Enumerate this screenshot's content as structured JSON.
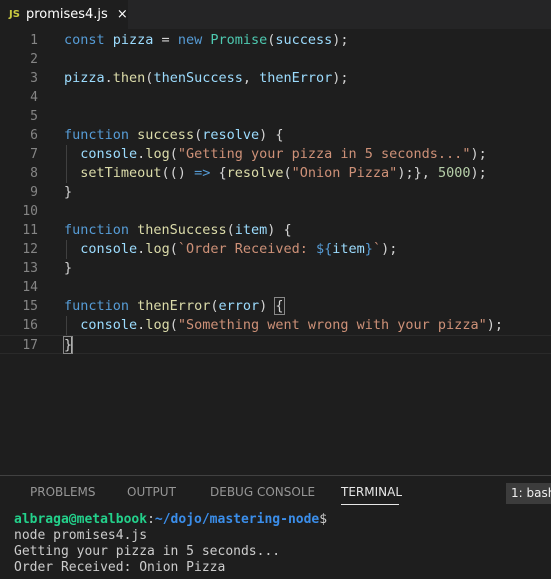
{
  "tab": {
    "badge": "JS",
    "filename": "promises4.js",
    "close": "×"
  },
  "editor": {
    "line_numbers": [
      "1",
      "2",
      "3",
      "4",
      "5",
      "6",
      "7",
      "8",
      "9",
      "10",
      "11",
      "12",
      "13",
      "14",
      "15",
      "16",
      "17"
    ],
    "lines": [
      [
        [
          "kw",
          "const"
        ],
        [
          "p",
          " "
        ],
        [
          "var",
          "pizza"
        ],
        [
          "p",
          " = "
        ],
        [
          "kw",
          "new"
        ],
        [
          "p",
          " "
        ],
        [
          "cls",
          "Promise"
        ],
        [
          "p",
          "("
        ],
        [
          "var",
          "success"
        ],
        [
          "p",
          ");"
        ]
      ],
      [],
      [
        [
          "var",
          "pizza"
        ],
        [
          "p",
          "."
        ],
        [
          "fn",
          "then"
        ],
        [
          "p",
          "("
        ],
        [
          "var",
          "thenSuccess"
        ],
        [
          "p",
          ", "
        ],
        [
          "var",
          "thenError"
        ],
        [
          "p",
          ");"
        ]
      ],
      [],
      [],
      [
        [
          "kw",
          "function"
        ],
        [
          "p",
          " "
        ],
        [
          "fn",
          "success"
        ],
        [
          "p",
          "("
        ],
        [
          "var",
          "resolve"
        ],
        [
          "p",
          ") {"
        ]
      ],
      [
        [
          "p",
          "  "
        ],
        [
          "var",
          "console"
        ],
        [
          "p",
          "."
        ],
        [
          "fn",
          "log"
        ],
        [
          "p",
          "("
        ],
        [
          "str",
          "\"Getting your pizza in 5 seconds...\""
        ],
        [
          "p",
          ");"
        ]
      ],
      [
        [
          "p",
          "  "
        ],
        [
          "fn",
          "setTimeout"
        ],
        [
          "p",
          "(() "
        ],
        [
          "kw",
          "=>"
        ],
        [
          "p",
          " {"
        ],
        [
          "fn",
          "resolve"
        ],
        [
          "p",
          "("
        ],
        [
          "str",
          "\"Onion Pizza\""
        ],
        [
          "p",
          ");}, "
        ],
        [
          "num",
          "5000"
        ],
        [
          "p",
          ");"
        ]
      ],
      [
        [
          "p",
          "}"
        ]
      ],
      [],
      [
        [
          "kw",
          "function"
        ],
        [
          "p",
          " "
        ],
        [
          "fn",
          "thenSuccess"
        ],
        [
          "p",
          "("
        ],
        [
          "var",
          "item"
        ],
        [
          "p",
          ") {"
        ]
      ],
      [
        [
          "p",
          "  "
        ],
        [
          "var",
          "console"
        ],
        [
          "p",
          "."
        ],
        [
          "fn",
          "log"
        ],
        [
          "p",
          "("
        ],
        [
          "str",
          "`Order Received: "
        ],
        [
          "kw",
          "${"
        ],
        [
          "var",
          "item"
        ],
        [
          "kw",
          "}"
        ],
        [
          "str",
          "`"
        ],
        [
          "p",
          ");"
        ]
      ],
      [
        [
          "p",
          "}"
        ]
      ],
      [],
      [
        [
          "kw",
          "function"
        ],
        [
          "p",
          " "
        ],
        [
          "fn",
          "thenError"
        ],
        [
          "p",
          "("
        ],
        [
          "var",
          "error"
        ],
        [
          "p",
          ") "
        ],
        [
          "hl",
          "{"
        ]
      ],
      [
        [
          "p",
          "  "
        ],
        [
          "var",
          "console"
        ],
        [
          "p",
          "."
        ],
        [
          "fn",
          "log"
        ],
        [
          "p",
          "("
        ],
        [
          "str",
          "\"Something went wrong with your pizza\""
        ],
        [
          "p",
          ");"
        ]
      ],
      [
        [
          "hl",
          "}"
        ],
        [
          "cursor",
          ""
        ]
      ]
    ]
  },
  "panel": {
    "tabs": [
      "PROBLEMS",
      "OUTPUT",
      "DEBUG CONSOLE",
      "TERMINAL"
    ],
    "active_tab": "TERMINAL",
    "terminal_select": "1: bash",
    "terminal": {
      "user_host": "albraga@metalbook",
      "colon": ":",
      "path": "~/dojo/mastering-node",
      "dollar": "$",
      "lines": [
        "node promises4.js",
        "Getting your pizza in 5 seconds...",
        "Order Received: Onion Pizza"
      ]
    }
  },
  "colors": {
    "keyword": "#569cd6",
    "function": "#dcdcaa",
    "variable": "#9cdcfe",
    "class": "#4ec9b0",
    "string": "#ce9178",
    "number": "#b5cea8",
    "background": "#1e1e1e",
    "terminal_user": "#23d18b",
    "terminal_path": "#3b8eea"
  }
}
